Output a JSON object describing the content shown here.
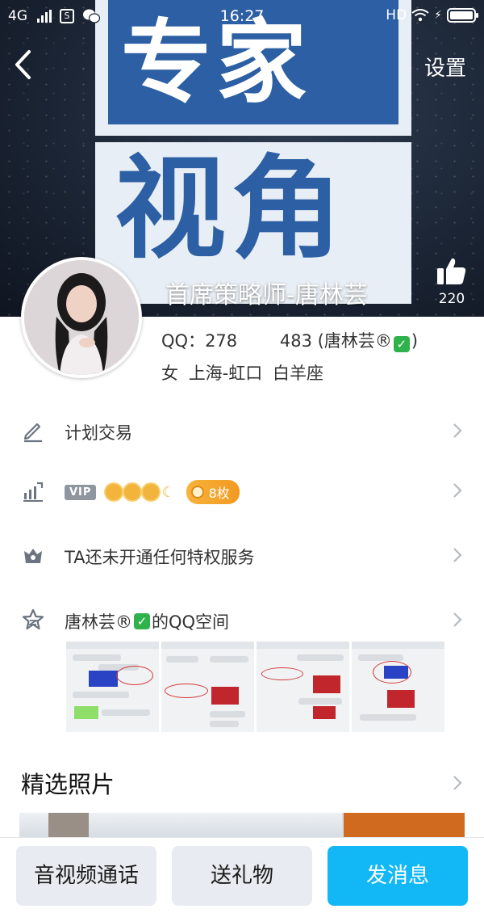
{
  "status_bar": {
    "network": "4G",
    "time": "16:27",
    "hd": "HD",
    "lightning": "⚡"
  },
  "header": {
    "settings_label": "设置",
    "banner_line1": "专家",
    "banner_line2": "视角",
    "nickname": "首席策略师-唐林芸",
    "like_count": "220"
  },
  "profile": {
    "qq_label": "QQ：",
    "qq_head": "278",
    "qq_tail": "483",
    "qq_suffix_open": "(唐林芸®",
    "qq_suffix_close": ")",
    "gender": "女",
    "location": "上海-虹口",
    "constellation": "白羊座"
  },
  "rows": {
    "plan": {
      "label": "计划交易"
    },
    "vip": {
      "badge": "VIP",
      "coin_count": "8枚"
    },
    "privilege": {
      "label": "TA还未开通任何特权服务"
    },
    "qzone": {
      "label_prefix": "唐林芸®",
      "label_suffix": "的QQ空间"
    }
  },
  "photos_section": {
    "title": "精选照片"
  },
  "bottom_bar": {
    "call_label": "音视频通话",
    "gift_label": "送礼物",
    "message_label": "发消息"
  },
  "colors": {
    "primary": "#12b7f5",
    "banner_blue": "#2c5fa3",
    "coin_orange": "#f29a21",
    "check_green": "#2fb24b"
  },
  "icons": {
    "plan": "pencil-icon",
    "vip": "chart-up-icon",
    "privilege": "crown-icon",
    "qzone": "star-icon",
    "like": "thumbs-up-icon",
    "back": "chevron-left-icon"
  }
}
